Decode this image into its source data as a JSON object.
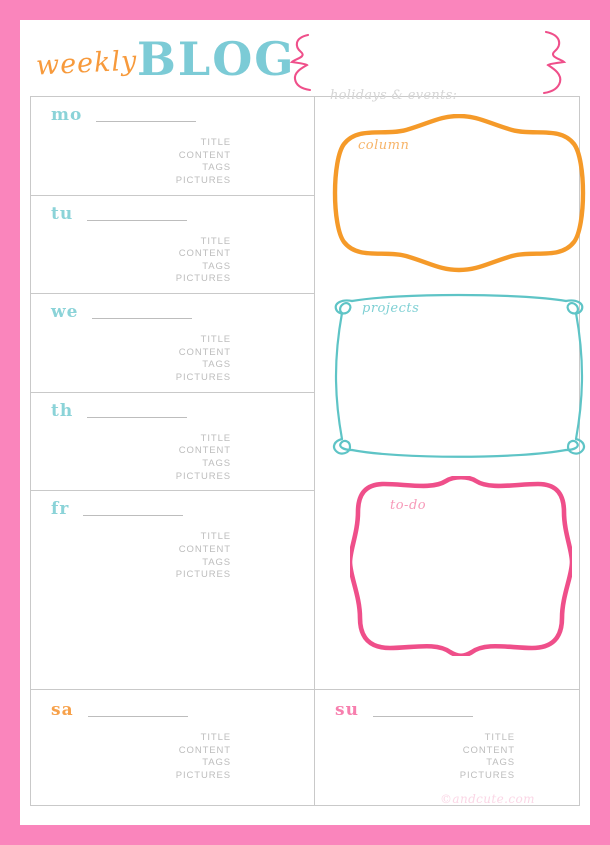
{
  "header": {
    "title_script": "weekly",
    "title_bold": "BLOG",
    "bracket_left": "squiggle-bracket-left",
    "bracket_right": "squiggle-bracket-right"
  },
  "right_panel": {
    "holidays_label": "holidays & events:",
    "frames": [
      {
        "label": "column",
        "color": "#f59a29",
        "shape": "ornate-wavy-frame"
      },
      {
        "label": "projects",
        "color": "#5ec4c6",
        "shape": "doodle-loop-frame"
      },
      {
        "label": "to-do",
        "color": "#ef4f8a",
        "shape": "ornate-notch-frame"
      }
    ]
  },
  "planner": {
    "fields": [
      "TITLE",
      "CONTENT",
      "TAGS",
      "PICTURES"
    ],
    "days": [
      {
        "abbr": "mo",
        "color": "#8bd3d8"
      },
      {
        "abbr": "tu",
        "color": "#8bd3d8"
      },
      {
        "abbr": "we",
        "color": "#8bd3d8"
      },
      {
        "abbr": "th",
        "color": "#8bd3d8"
      },
      {
        "abbr": "fr",
        "color": "#8bd3d8"
      }
    ],
    "weekend": [
      {
        "abbr": "sa",
        "color": "#f7a14a"
      },
      {
        "abbr": "su",
        "color": "#f municipal"
      }
    ]
  },
  "footer": {
    "watermark": "©andcute.com"
  },
  "colors": {
    "border_pink": "#fa85bc",
    "orange": "#f59a29",
    "teal": "#5ec4c6",
    "pink": "#ef4f8a",
    "rule_gray": "#c9c9c9",
    "text_gray": "#bdbdbd"
  }
}
